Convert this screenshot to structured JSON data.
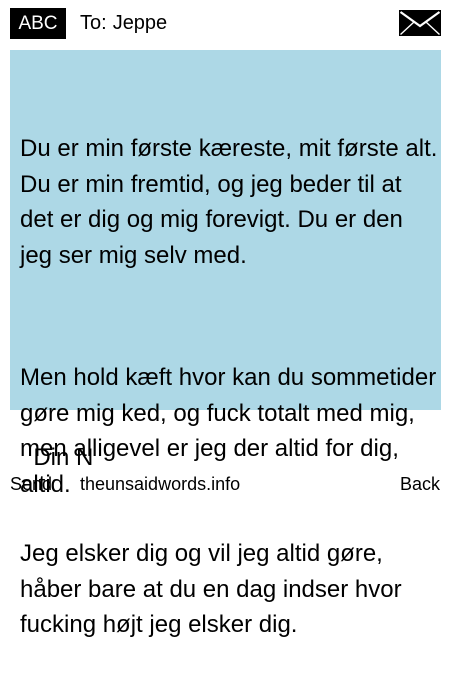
{
  "header": {
    "mode_label": "ABC",
    "to_label": "To:",
    "recipient": "Jeppe",
    "icon": "envelope-icon"
  },
  "message": {
    "paragraphs": [
      "Du er min første kæreste, mit første alt. Du er min fremtid, og jeg beder til at det er dig og mig forevigt. Du er den jeg ser mig selv med.",
      "Men hold kæft hvor kan du sommetider gøre mig ked, og fuck totalt med mig, men alligevel er jeg der altid for dig, altid.",
      "Jeg elsker dig og vil jeg altid gøre, håber bare at du en dag indser hvor fucking højt jeg elsker dig.",
      "Din N"
    ]
  },
  "softkeys": {
    "left": "Send",
    "center": "theunsaidwords.info",
    "right": "Back"
  },
  "colors": {
    "message_background": "#add8e6",
    "mode_background": "#000000"
  }
}
